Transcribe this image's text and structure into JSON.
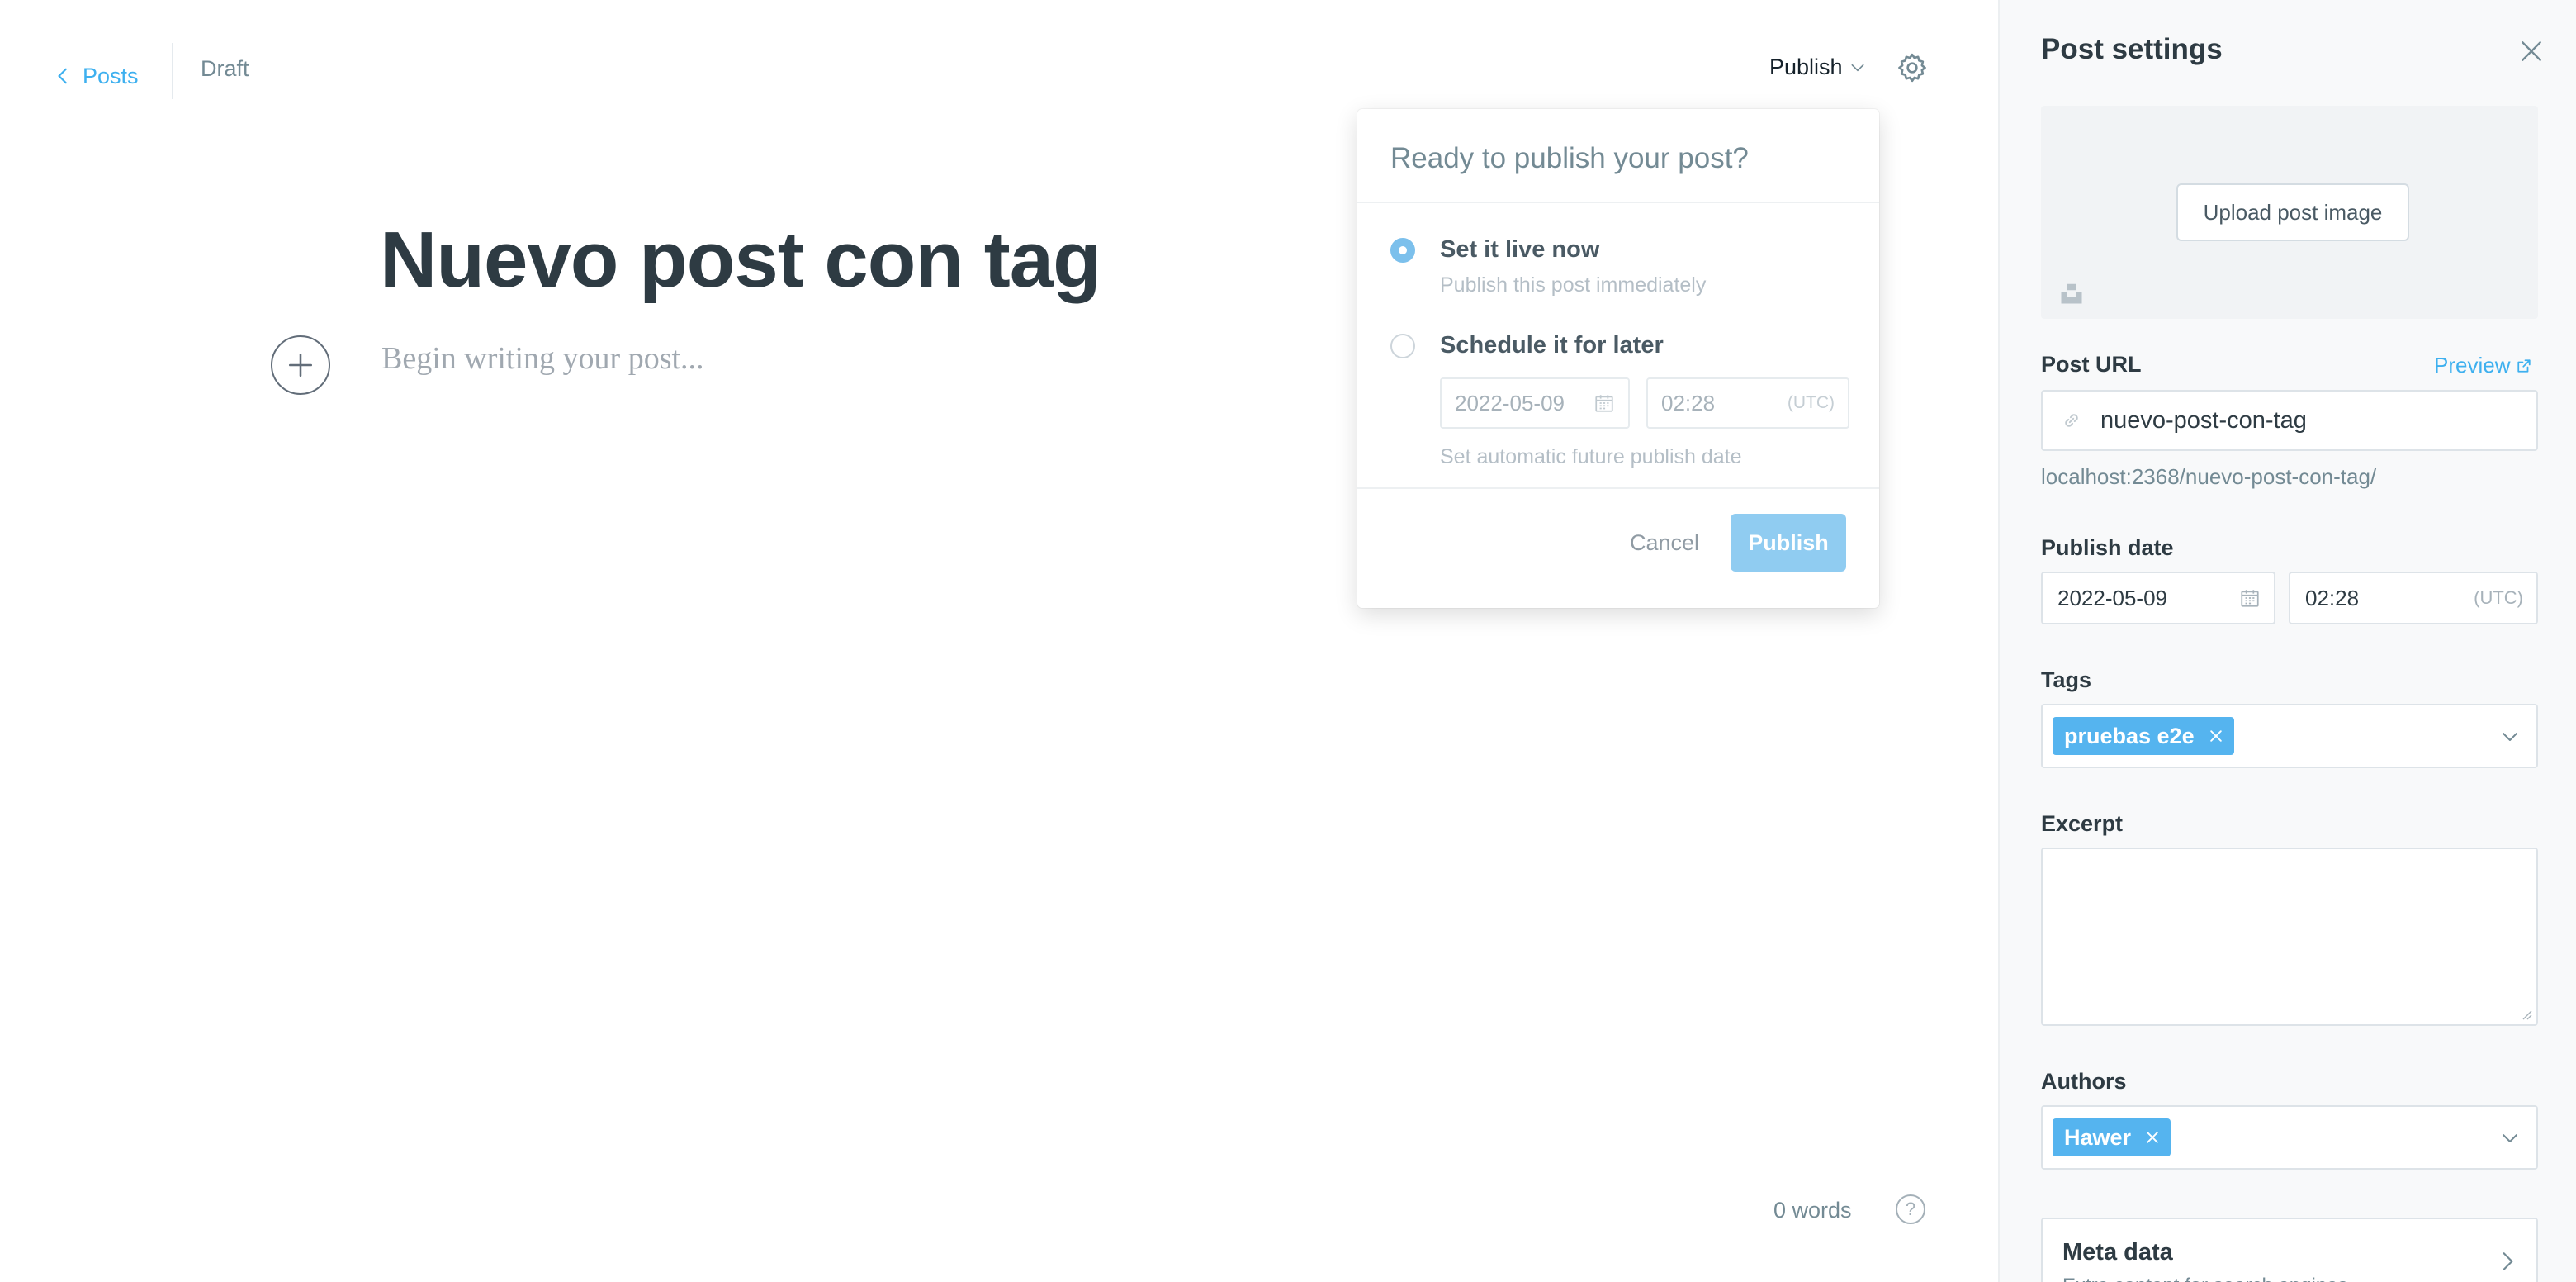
{
  "header": {
    "back_label": "Posts",
    "status": "Draft",
    "publish_label": "Publish"
  },
  "editor": {
    "title": "Nuevo post con tag",
    "body_placeholder": "Begin writing your post...",
    "word_count": "0 words",
    "help_glyph": "?"
  },
  "publish_menu": {
    "heading": "Ready to publish your post?",
    "option_now": {
      "label": "Set it live now",
      "description": "Publish this post immediately",
      "selected": true
    },
    "option_schedule": {
      "label": "Schedule it for later",
      "date": "2022-05-09",
      "time": "02:28",
      "timezone": "(UTC)",
      "description": "Set automatic future publish date"
    },
    "cancel_label": "Cancel",
    "publish_label": "Publish"
  },
  "settings": {
    "title": "Post settings",
    "upload_image_label": "Upload post image",
    "post_url_label": "Post URL",
    "preview_label": "Preview",
    "slug": "nuevo-post-con-tag",
    "url_hint": "localhost:2368/nuevo-post-con-tag/",
    "publish_date_label": "Publish date",
    "publish_date": "2022-05-09",
    "publish_time": "02:28",
    "publish_timezone": "(UTC)",
    "tags_label": "Tags",
    "tags": [
      "pruebas e2e"
    ],
    "excerpt_label": "Excerpt",
    "excerpt_value": "",
    "authors_label": "Authors",
    "authors": [
      "Hawer"
    ],
    "meta_title": "Meta data",
    "meta_desc": "Extra content for search engines"
  },
  "colors": {
    "accent": "#3eb0ef",
    "token": "#55b4ef",
    "publish_button_disabled": "#90ccf1",
    "sidebar_bg": "#f8f9fa"
  },
  "icons": [
    "chevron-left-icon",
    "chevron-down-icon",
    "gear-icon",
    "plus-icon",
    "help-icon",
    "calendar-icon",
    "close-icon",
    "link-icon",
    "external-link-icon",
    "unsplash-icon",
    "chevron-right-icon"
  ]
}
